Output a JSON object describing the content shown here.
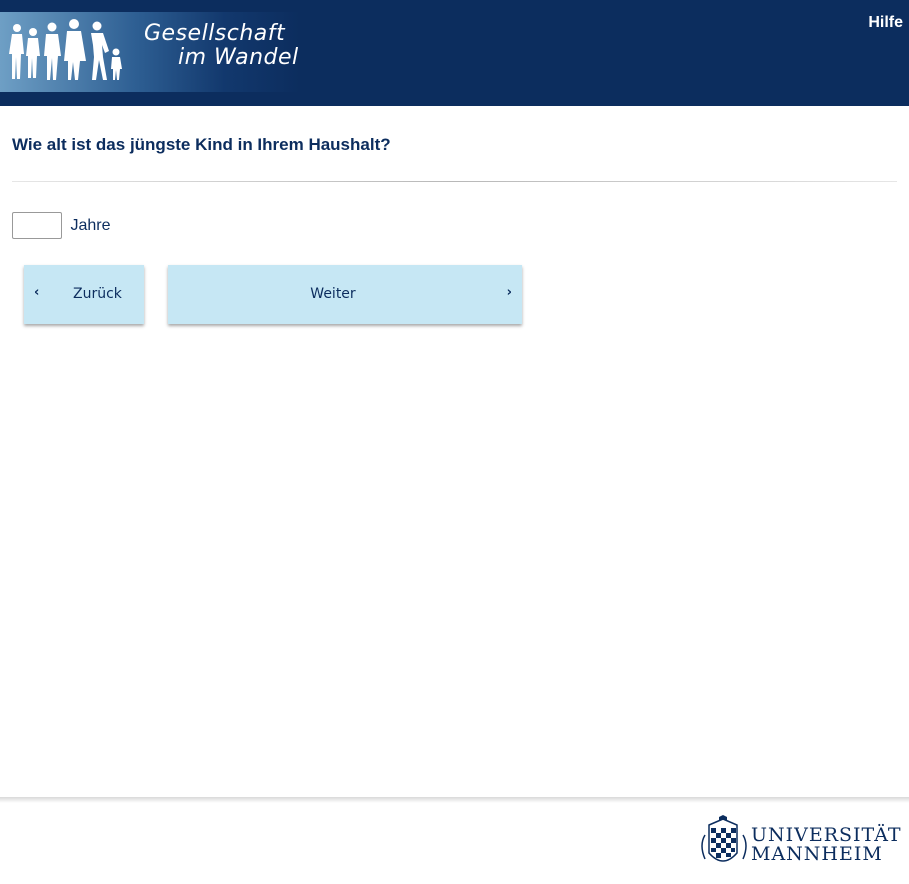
{
  "header": {
    "logo_line1": "Gesellschaft",
    "logo_line2": "im Wandel",
    "help_label": "Hilfe"
  },
  "question": {
    "text": "Wie alt ist das jüngste Kind in Ihrem Haushalt?",
    "input_value": "",
    "unit_label": "Jahre"
  },
  "navigation": {
    "back_label": "Zurück",
    "next_label": "Weiter"
  },
  "footer": {
    "university_line1": "UNIVERSITÄT",
    "university_line2": "MANNHEIM"
  },
  "colors": {
    "header_bg": "#0c2d5e",
    "button_bg": "#c6e7f4",
    "text": "#0c2d5e"
  }
}
